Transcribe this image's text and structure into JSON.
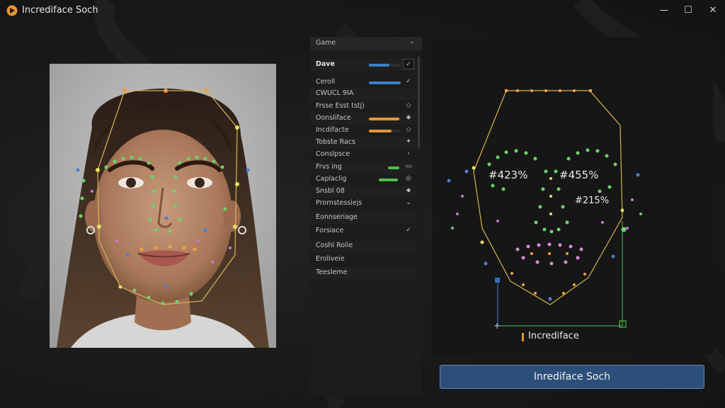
{
  "window": {
    "title": "Incrediface Soch",
    "brand_color": "#e6962e"
  },
  "settings": {
    "header": "Game",
    "rows": [
      {
        "label": "Dave",
        "bold": true,
        "bar_color": "#3c82c8",
        "value": 0.65,
        "control": "✓",
        "control_boxed": true
      },
      {
        "label": "Ceroll",
        "bar_color": "#3c82c8",
        "value": 1.0,
        "control": "✓",
        "control_boxed": false
      },
      {
        "label": "CWUCL 9IA"
      },
      {
        "label": "Frsse Esst tstj)",
        "control": "◇"
      },
      {
        "label": "Oonsliface",
        "bar_color": "#e6962e",
        "value": 0.95,
        "control": "⬥"
      },
      {
        "label": "Incdifacte",
        "bar_color": "#e6962e",
        "value": 0.72,
        "control": "◇"
      },
      {
        "label": "Tobste Racs",
        "control": "✦"
      },
      {
        "label": "Conslpsce",
        "control": "›"
      },
      {
        "label": "Frvs ing",
        "bar_color": "#4cc247",
        "value": 0.35,
        "bar_offset": 0.6,
        "control": "▭"
      },
      {
        "label": "Caplaclig",
        "bar_color": "#4cc247",
        "value": 0.6,
        "bar_offset": 0.3,
        "control": "◎"
      },
      {
        "label": "Snsbl 08",
        "control": "⬥"
      },
      {
        "label": "Prornstessiejs",
        "control": "⌄"
      },
      {
        "label": "Eonnseriage"
      },
      {
        "label": "Forsiace",
        "control": "✓"
      },
      {
        "label": "Coshl Rolie"
      },
      {
        "label": "Eroliveie"
      },
      {
        "label": "Teesleme"
      }
    ]
  },
  "mesh": {
    "left_eye_pct": "#423%",
    "right_eye_pct": "#455%",
    "nose_pct": "#215%",
    "caption": "Incrediface"
  },
  "action_button": {
    "label": "Inrediface Soch"
  }
}
